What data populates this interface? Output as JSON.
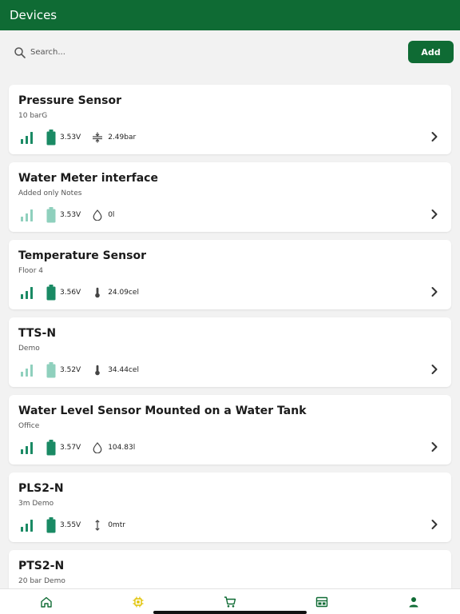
{
  "header": {
    "title": "Devices"
  },
  "search": {
    "placeholder": "Search..."
  },
  "toolbar": {
    "add_label": "Add"
  },
  "colors": {
    "brand": "#0f6b34",
    "accent": "#1a8a64",
    "accent_faded": "#8fd0bd"
  },
  "devices": [
    {
      "name": "Pressure Sensor",
      "subtitle": "10 barG",
      "battery": "3.53V",
      "reading": "2.49bar",
      "metric_icon": "pressure-icon",
      "signal_level": "strong"
    },
    {
      "name": "Water Meter interface",
      "subtitle": "Added only Notes",
      "battery": "3.53V",
      "reading": "0l",
      "metric_icon": "water-drop-icon",
      "signal_level": "weak"
    },
    {
      "name": "Temperature Sensor",
      "subtitle": "Floor 4",
      "battery": "3.56V",
      "reading": "24.09cel",
      "metric_icon": "thermometer-icon",
      "signal_level": "strong"
    },
    {
      "name": "TTS-N",
      "subtitle": "Demo",
      "battery": "3.52V",
      "reading": "34.44cel",
      "metric_icon": "thermometer-icon",
      "signal_level": "weak"
    },
    {
      "name": "Water Level Sensor Mounted on a Water Tank",
      "subtitle": "Office",
      "battery": "3.57V",
      "reading": "104.83l",
      "metric_icon": "water-drop-icon",
      "signal_level": "strong"
    },
    {
      "name": "PLS2-N",
      "subtitle": "3m Demo",
      "battery": "3.55V",
      "reading": "0mtr",
      "metric_icon": "vertical-arrows-icon",
      "signal_level": "strong"
    },
    {
      "name": "PTS2-N",
      "subtitle": "20 bar Demo"
    }
  ],
  "nav": [
    {
      "icon": "home-icon",
      "color": "#0f6b34"
    },
    {
      "icon": "chip-icon",
      "color": "#e0c200",
      "active": true
    },
    {
      "icon": "cart-icon",
      "color": "#0f6b34"
    },
    {
      "icon": "dashboard-icon",
      "color": "#0f6b34"
    },
    {
      "icon": "person-icon",
      "color": "#0f6b34"
    }
  ]
}
